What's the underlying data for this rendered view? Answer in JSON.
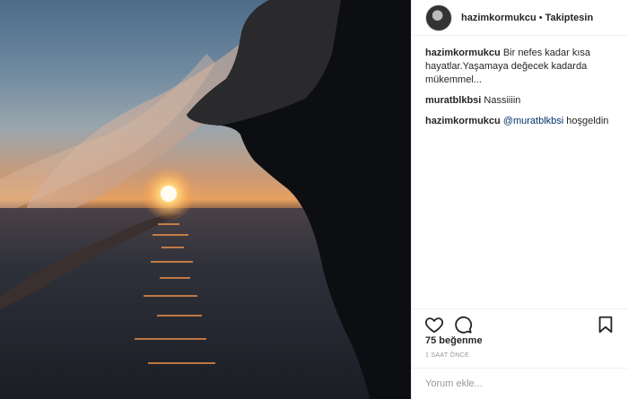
{
  "post": {
    "image_alt": "sunset-silhouette-photo"
  },
  "header": {
    "username": "hazimkormukcu",
    "separator": "•",
    "follow_status": "Takiptesin"
  },
  "comments": [
    {
      "user": "hazimkormukcu",
      "text": "Bir nefes kadar kısa hayatlar.Yaşamaya değecek kadarda mükemmel..."
    },
    {
      "user": "muratblkbsi",
      "text": "Nassiiiin"
    },
    {
      "user": "hazimkormukcu",
      "mention": "@muratblkbsi",
      "text": "hoşgeldin"
    }
  ],
  "actions": {
    "like_icon": "heart-icon",
    "comment_icon": "comment-bubble-icon",
    "save_icon": "bookmark-icon"
  },
  "likes_text": "75 beğenme",
  "time_text": "1 SAAT ÖNCE",
  "comment_input": {
    "placeholder": "Yorum ekle..."
  },
  "colors": {
    "mention": "#003569",
    "border": "#efefef",
    "text": "#262626",
    "muted": "#999999"
  }
}
